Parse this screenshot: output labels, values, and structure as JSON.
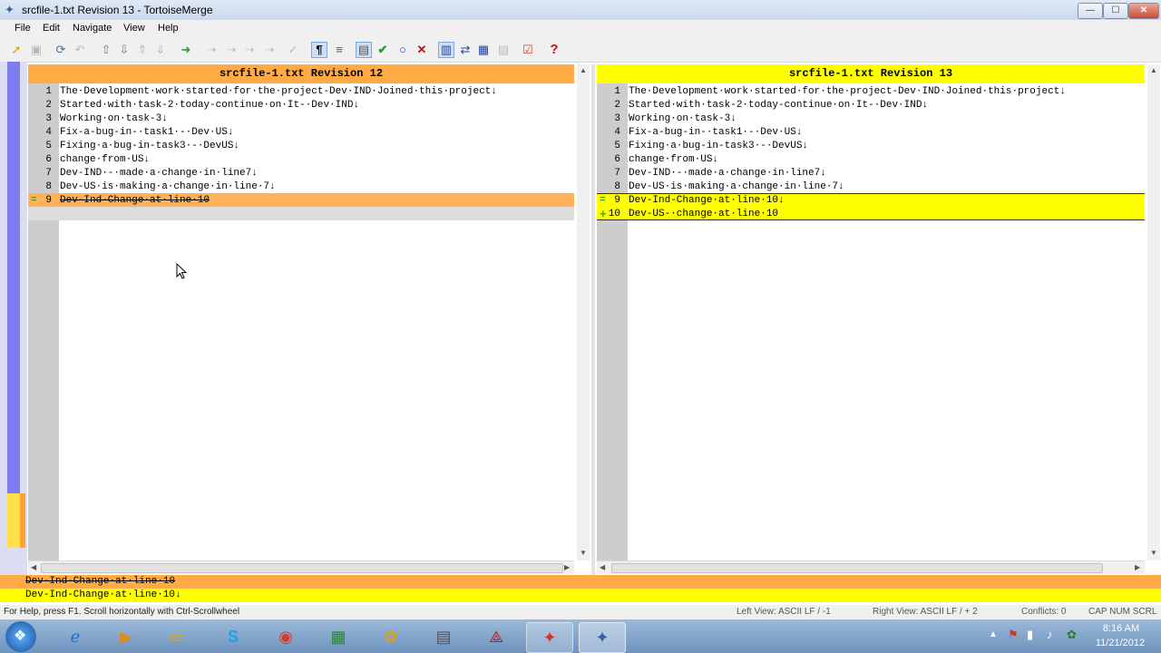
{
  "window": {
    "title": "srcfile-1.txt Revision 13 - TortoiseMerge",
    "min": "—",
    "max": "☐",
    "close": "✕"
  },
  "menu": [
    "File",
    "Edit",
    "Navigate",
    "View",
    "Help"
  ],
  "left_pane": {
    "header": "srcfile-1.txt Revision 12",
    "lines": [
      {
        "num": "1",
        "text": "The·Development·work·started·for·the·project-Dev·IND·Joined·this·project↓"
      },
      {
        "num": "2",
        "text": "Started·with·task-2·today-continue·on·It-·Dev·IND↓"
      },
      {
        "num": "3",
        "text": "Working·on·task-3↓"
      },
      {
        "num": "4",
        "text": "Fix-a-bug-in-·task1·-·Dev·US↓"
      },
      {
        "num": "5",
        "text": "Fixing·a·bug-in-task3·-·DevUS↓"
      },
      {
        "num": "6",
        "text": "change·from·US↓"
      },
      {
        "num": "7",
        "text": "Dev-IND·-·made·a·change·in·line7↓"
      },
      {
        "num": "8",
        "text": "Dev-US·is·making·a·change·in·line·7↓"
      },
      {
        "num": "9",
        "text": "Dev-Ind-Change·at·line·10",
        "marker": "="
      }
    ]
  },
  "right_pane": {
    "header": "srcfile-1.txt Revision 13",
    "lines": [
      {
        "num": "1",
        "text": "The·Development·work·started·for·the·project-Dev·IND·Joined·this·project↓"
      },
      {
        "num": "2",
        "text": "Started·with·task-2·today-continue·on·It-·Dev·IND↓"
      },
      {
        "num": "3",
        "text": "Working·on·task-3↓"
      },
      {
        "num": "4",
        "text": "Fix-a-bug-in-·task1·-·Dev·US↓"
      },
      {
        "num": "5",
        "text": "Fixing·a·bug-in-task3·-·DevUS↓"
      },
      {
        "num": "6",
        "text": "change·from·US↓"
      },
      {
        "num": "7",
        "text": "Dev-IND·-·made·a·change·in·line7↓"
      },
      {
        "num": "8",
        "text": "Dev-US·is·making·a·change·in·line·7↓"
      },
      {
        "num": "9",
        "text": "Dev-Ind-Change·at·line·10↓",
        "marker": "="
      },
      {
        "num": "10",
        "text": "Dev-US-·change·at·line·10",
        "marker": "+"
      }
    ]
  },
  "bottom_view": {
    "removed": "Dev-Ind-Change·at·line·10",
    "current": "Dev-Ind-Change·at·line·10↓"
  },
  "status": {
    "help": "For Help, press F1. Scroll horizontally with Ctrl-Scrollwheel",
    "left_view": "Left View: ASCII LF  / -1",
    "right_view": "Right View: ASCII LF  / + 2",
    "conflicts": "Conflicts: 0",
    "keys": "CAP  NUM  SCRL"
  },
  "taskbar": {
    "time": "8:16 AM",
    "date": "11/21/2012"
  },
  "colors": {
    "left_header": "#ffaa44",
    "right_header": "#ffff00",
    "removed_bg": "#ffb25a",
    "added_bg": "#ffff00",
    "gutter": "#cdcdcd"
  }
}
